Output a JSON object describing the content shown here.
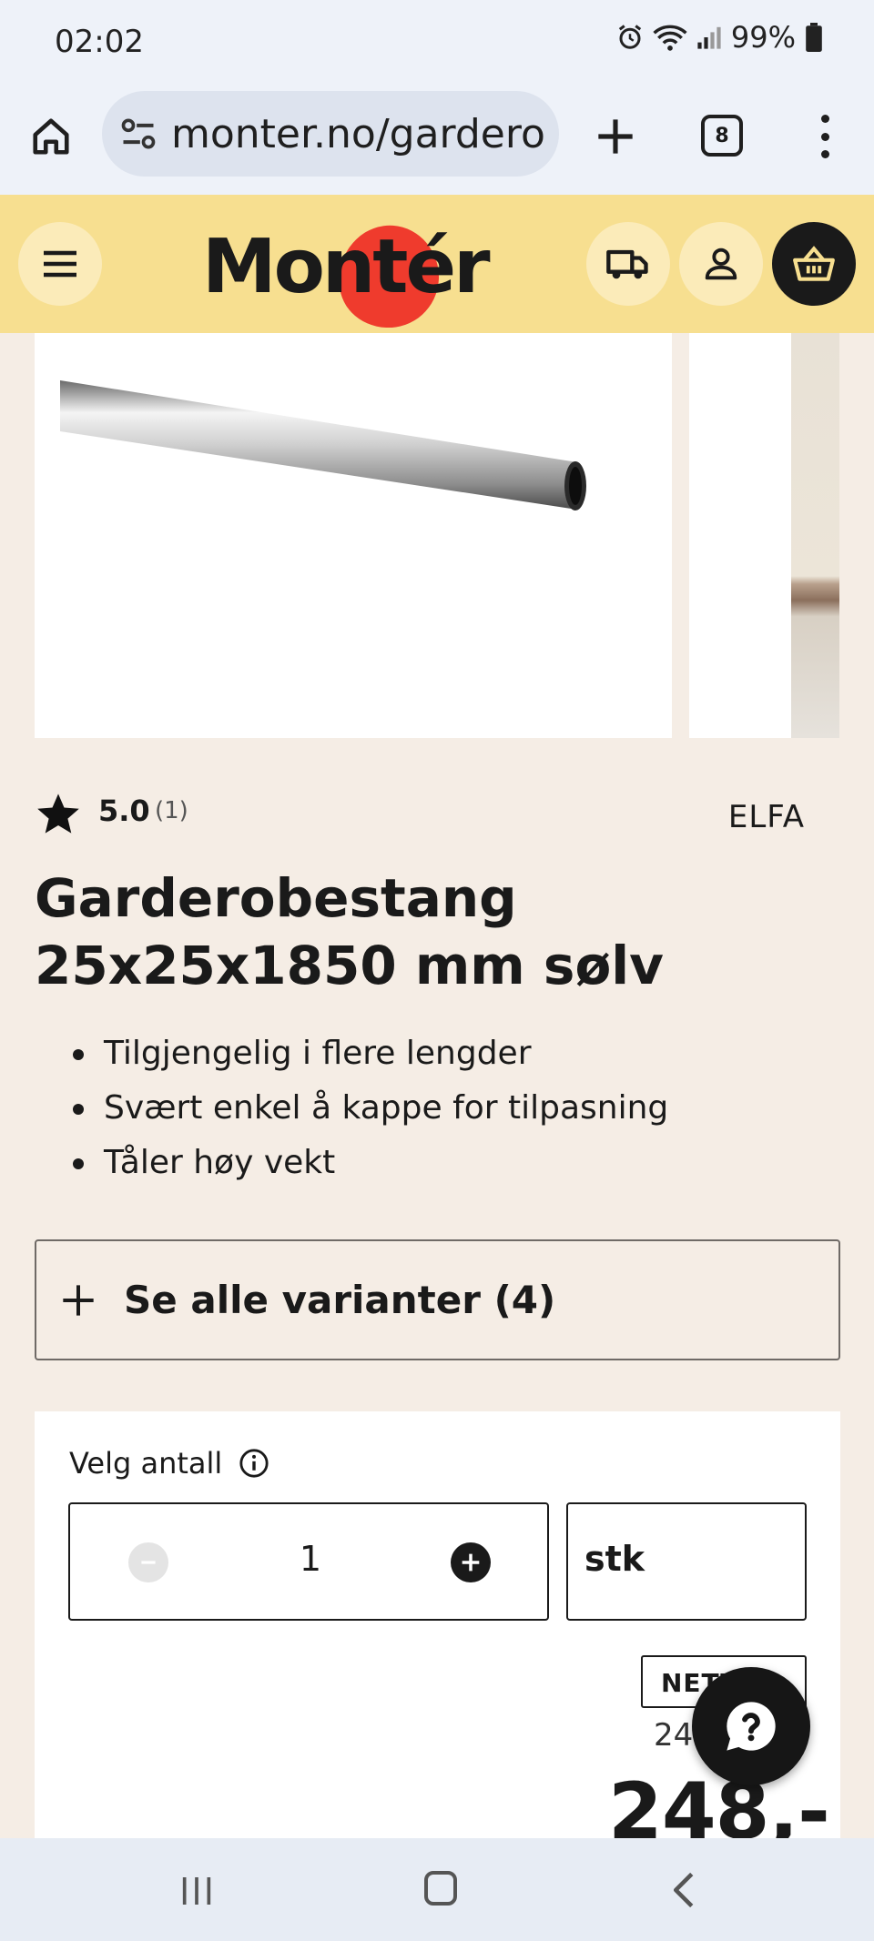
{
  "status_bar": {
    "time": "02:02",
    "battery": "99%"
  },
  "browser": {
    "url": "monter.no/gardero",
    "tab_count": "8"
  },
  "site": {
    "logo_text": "Montér"
  },
  "product": {
    "rating": "5.0",
    "rating_count": "(1)",
    "brand": "ELFA",
    "title": "Garderobestang 25x25x1850 mm sølv",
    "bullets": [
      "Tilgjengelig i flere lengder",
      "Svært enkel å kappe for tilpasning",
      "Tåler høy vekt"
    ],
    "variants_label": "Se alle varianter (4)"
  },
  "purchase": {
    "quantity_label": "Velg antall",
    "quantity": "1",
    "unit": "stk",
    "badge": "NETT",
    "old_price": "24",
    "price": "248,-"
  },
  "colors": {
    "header_bg": "#f7df90",
    "page_bg": "#f5ede5",
    "logo_red": "#ef3b2d",
    "dark": "#1a1a1a"
  }
}
